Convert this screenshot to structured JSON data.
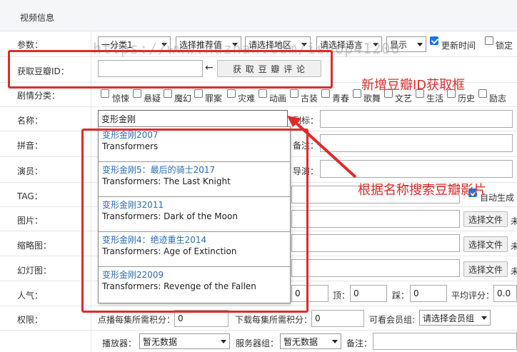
{
  "header": {
    "title": "视频信息"
  },
  "watermark": "https://www.huzhan.com/ishop41200",
  "rows": {
    "params": {
      "label": "参数：",
      "selects": [
        "一分类1",
        "选择推荐值",
        "请选择地区",
        "请选择语言",
        "显示"
      ],
      "update_time_label": "更新时间",
      "lock_label": "锁定"
    },
    "douban": {
      "label": "获取豆瓣ID：",
      "arrow": "←",
      "button": "获 取 豆 瓣 评 论",
      "input_value": ""
    },
    "genre": {
      "label": "剧情分类：",
      "options": [
        "惊悚",
        "悬疑",
        "魔幻",
        "罪案",
        "灾难",
        "动画",
        "古装",
        "青春",
        "歌舞",
        "文艺",
        "生活",
        "历史",
        "励志"
      ]
    },
    "name": {
      "label": "名称：",
      "value": "变形金刚",
      "subtitle_label": "副标："
    },
    "pinyin": {
      "label": "拼音：",
      "note_label": "备注："
    },
    "actors": {
      "label": "演员：",
      "director_label": "导演："
    },
    "tag": {
      "label": "TAG：",
      "auto_gen_label": "自动生成"
    },
    "pic": {
      "label": "图片：",
      "choose_file": "选择文件",
      "no_file": "未"
    },
    "thumb": {
      "label": "缩略图：",
      "choose_file": "选择文件",
      "no_file": "未"
    },
    "slide": {
      "label": "幻灯图：",
      "choose_file": "选择文件",
      "no_file": "未"
    },
    "popularity": {
      "label": "人气：",
      "value1": "0",
      "up_label": "顶：",
      "up_value": "0",
      "down_label": "踩：",
      "down_value": "0",
      "score_label": "平均评分：",
      "score_value": "0.0"
    },
    "permission": {
      "label": "权限：",
      "play_points_label": "点播每集所需积分：",
      "play_points_value": "0",
      "download_points_label": "下载每集所需积分：",
      "download_points_value": "0",
      "member_group_label": "可看会员组:",
      "member_group_value": "请选择会员组"
    },
    "player": {
      "player_label": "播放器：",
      "player_value": "暂无数据",
      "server_label": "服务器组：",
      "server_value": "暂无数据",
      "note_label": "备注："
    }
  },
  "dropdown": [
    {
      "title": "变形金刚2007",
      "subtitle": "Transformers"
    },
    {
      "title": "变形金刚5：最后的骑士2017",
      "subtitle": "Transformers: The Last Knight"
    },
    {
      "title": "变形金刚32011",
      "subtitle": "Transformers: Dark of the Moon"
    },
    {
      "title": "变形金刚4：绝迹重生2014",
      "subtitle": "Transformers: Age of Extinction"
    },
    {
      "title": "变形金刚22009",
      "subtitle": "Transformers: Revenge of the Fallen"
    }
  ],
  "annotations": {
    "douban_box": "新增豆瓣ID获取框",
    "search_box": "根据名称搜索豆瓣影片"
  },
  "colors": {
    "annotation": "#e02a2a",
    "link": "#2a6cb8",
    "checkbox_checked": "#1a73e8"
  }
}
